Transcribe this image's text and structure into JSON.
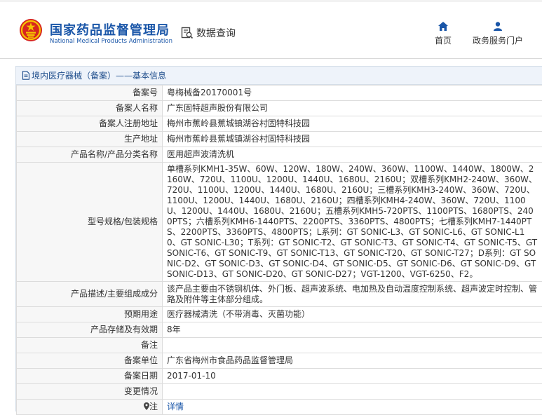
{
  "header": {
    "brand_cn": "国家药品监督管理局",
    "brand_en": "National Medical Products Administration",
    "query_label": "数据查询",
    "nav": [
      {
        "label": "首页",
        "icon": "home-icon"
      },
      {
        "label": "政务服务门户",
        "icon": "user-icon"
      }
    ]
  },
  "panel": {
    "title": "境内医疗器械（备案）——基本信息"
  },
  "rows": [
    {
      "key": "备案号",
      "value": "粤梅械备20170001号"
    },
    {
      "key": "备案人名称",
      "value": "广东固特超声股份有限公司"
    },
    {
      "key": "备案人注册地址",
      "value": "梅州市蕉岭县蕉城镇湖谷村固特科技园"
    },
    {
      "key": "生产地址",
      "value": "梅州市蕉岭县蕉城镇湖谷村固特科技园"
    },
    {
      "key": "产品名称/产品分类名称",
      "value": "医用超声波清洗机"
    },
    {
      "key": "型号规格/包装规格",
      "value": "单槽系列KMH1-35W、60W、120W、180W、240W、360W、1100W、1440W、1800W、2160W、720U、1100U、1200U、1440U、1680U、2160U；双槽系列KMH2-240W、360W、720U、1100U、1200U、1440U、1680U、2160U；三槽系列KMH3-240W、360W、720U、1100U、1200U、1440U、1680U、2160U；四槽系列KMH4-240W、360W、720U、1100U、1200U、1440U、1680U、2160U；五槽系列KMH5-720PTS、1100PTS、1680PTS、2400PTS；六槽系列KMH6-1440PTS、2200PTS、3360PTS、4800PTS；七槽系列KMH7-1440PTS、2200PTS、3360PTS、4800PTS；L系列：GT SONIC-L3、GT SONIC-L6、GT SONIC-L10、GT SONIC-L30；T系列：GT SONIC-T2、GT SONIC-T3、GT SONIC-T4、GT SONIC-T5、GT SONIC-T6、GT SONIC-T9、GT SONIC-T13、GT SONIC-T20、GT SONIC-T27；D系列：GT SONIC-D2、GT SONIC-D3、GT SONIC-D4、GT SONIC-D5、GT SONIC-D6、GT SONIC-D9、GT SONIC-D13、GT SONIC-D20、GT SONIC-D27；VGT-1200、VGT-6250、F2。"
    },
    {
      "key": "产品描述/主要组成成分",
      "value": "该产品主要由不锈钢机体、外门板、超声波系统、电加热及自动温度控制系统、超声波定时控制、管路及附件等主体部分组成。"
    },
    {
      "key": "预期用途",
      "value": "医疗器械清洗（不带消毒、灭菌功能）"
    },
    {
      "key": "产品存储及有效期",
      "value": "8年"
    },
    {
      "key": "备注",
      "value": ""
    },
    {
      "key": "备案单位",
      "value": "广东省梅州市食品药品监督管理局"
    },
    {
      "key": "备案日期",
      "value": "2017-01-10"
    },
    {
      "key": "变更情况",
      "value": ""
    },
    {
      "key": "注",
      "value": "详情"
    }
  ],
  "colors": {
    "brand_blue": "#1a56a8",
    "emblem_red": "#d7261e",
    "emblem_gold": "#f5c400"
  }
}
